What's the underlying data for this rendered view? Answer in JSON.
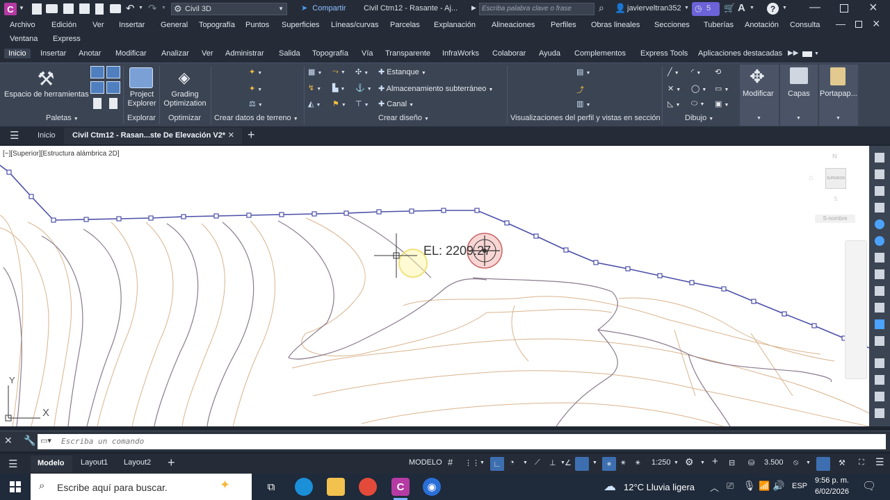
{
  "titlebar": {
    "app_badge": "C",
    "workspace": "Civil 3D",
    "share": "Compartir",
    "doc_title": "Civil Ctm12 - Rasante - Aj...",
    "search_placeholder": "Escriba palabra clave o frase",
    "user": "javierveltran352",
    "timer": "5",
    "help": "?"
  },
  "menu": {
    "row1": [
      "Archivo",
      "Edición",
      "Ver",
      "Insertar",
      "General",
      "Topografía",
      "Puntos",
      "Superficies",
      "Líneas/curvas",
      "Parcelas",
      "Explanación",
      "Alineaciones",
      "Perfiles",
      "Obras lineales",
      "Secciones",
      "Tuberías",
      "Anotación",
      "Consulta"
    ],
    "row2": [
      "Ventana",
      "Express"
    ]
  },
  "ribbon_tabs": [
    "Inicio",
    "Insertar",
    "Anotar",
    "Modificar",
    "Analizar",
    "Ver",
    "Administrar",
    "Salida",
    "Topografía",
    "Vía",
    "Transparente",
    "InfraWorks",
    "Colaborar",
    "Ayuda",
    "Complementos",
    "Express Tools",
    "Aplicaciones destacadas"
  ],
  "ribbon": {
    "tools_label": "Espacio de herramientas",
    "project_explorer": "Project Explorer",
    "grading": "Grading Optimization",
    "estanque": "Estanque",
    "almacenamiento": "Almacenamiento subterráneo",
    "canal": "Canal",
    "modificar": "Modificar",
    "capas": "Capas",
    "portapapeles": "Portapap...",
    "panels": {
      "paletas": "Paletas",
      "explorar": "Explorar",
      "optimizar": "Optimizar",
      "crear_datos": "Crear datos de terreno",
      "crear_diseno": "Crear diseño",
      "visualizaciones": "Visualizaciones del perfil y vistas en sección",
      "dibujo": "Dibujo"
    }
  },
  "doctabs": {
    "inicio": "Inicio",
    "active": "Civil Ctm12 - Rasan...ste De Elevación V2*",
    "add": "+"
  },
  "viewport": {
    "label": "[−][Superior][Estructura alámbrica 2D]",
    "elevation_label": "EL: 2209.27",
    "viewcube_face": "SUPERIOR",
    "viewcube_n": "N",
    "viewcube_s": "S",
    "wcs_name": "S-nombre",
    "ucs_y": "Y",
    "ucs_x": "X"
  },
  "command": {
    "placeholder": "Escriba un comando"
  },
  "status": {
    "tabs": [
      "Modelo",
      "Layout1",
      "Layout2"
    ],
    "model_label": "MODELO",
    "scale": "1:250",
    "elevation_scale": "3.500"
  },
  "taskbar": {
    "search_placeholder": "Escribe aquí para buscar.",
    "weather": "12°C  Lluvia ligera",
    "lang": "ESP",
    "time": "9:56 p. m.",
    "date": "6/02/2026"
  },
  "colors": {
    "alignment": "#4a4ea6",
    "contour_major": "#8a7a8c",
    "contour_minor": "#d9b38c",
    "accent": "#5b8fd9"
  }
}
